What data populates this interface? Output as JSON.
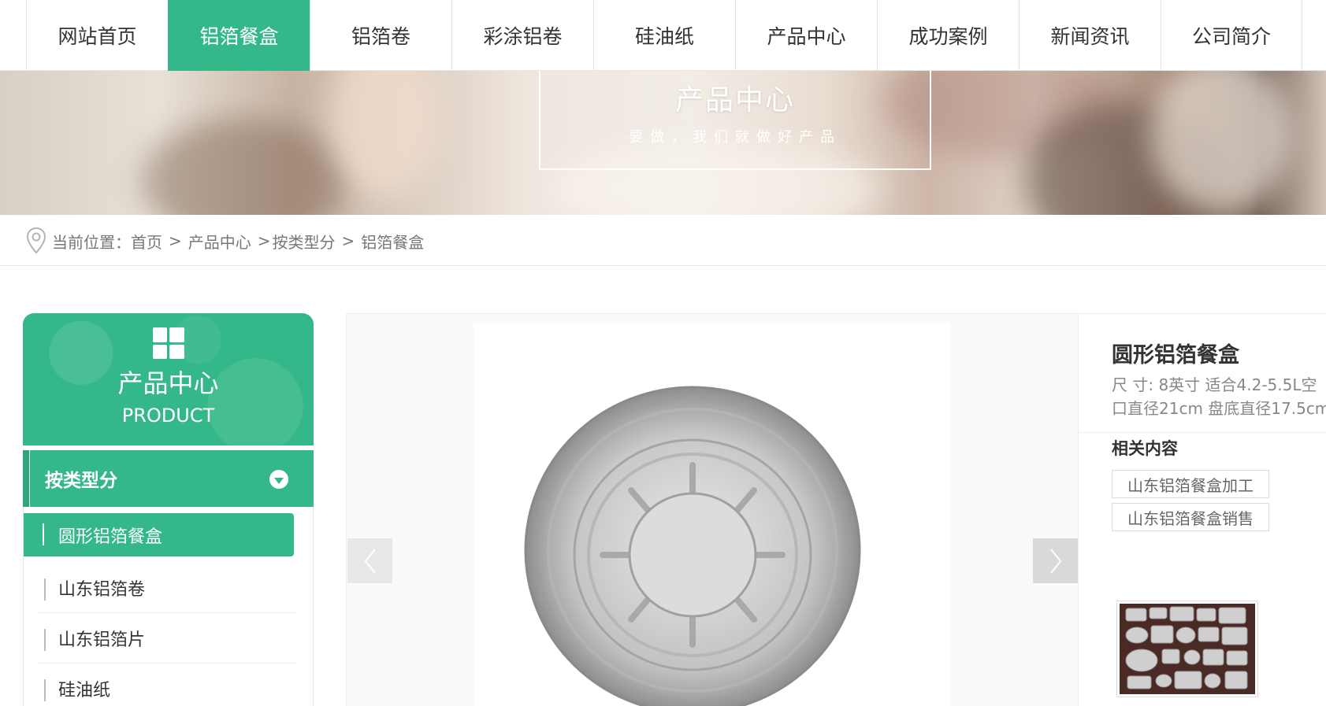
{
  "nav": {
    "items": [
      {
        "label": "网站首页",
        "active": false
      },
      {
        "label": "铝箔餐盒",
        "active": true
      },
      {
        "label": "铝箔卷",
        "active": false
      },
      {
        "label": "彩涂铝卷",
        "active": false
      },
      {
        "label": "硅油纸",
        "active": false
      },
      {
        "label": "产品中心",
        "active": false
      },
      {
        "label": "成功案例",
        "active": false
      },
      {
        "label": "新闻资讯",
        "active": false
      },
      {
        "label": "公司简介",
        "active": false
      }
    ]
  },
  "banner": {
    "title": "产品中心",
    "subtitle": "要做，我们就做好产品"
  },
  "breadcrumb": {
    "prefix": "当前位置：",
    "items": [
      "首页",
      "产品中心",
      "按类型分",
      "铝箔餐盒"
    ],
    "separators": [
      ">",
      ">",
      ">"
    ]
  },
  "sidebar": {
    "title": "产品中心",
    "title_en": "PRODUCT",
    "category": "按类型分",
    "items": [
      {
        "label": "圆形铝箔餐盒",
        "active": true
      },
      {
        "label": "山东铝箔卷",
        "active": false
      },
      {
        "label": "山东铝箔片",
        "active": false
      },
      {
        "label": "硅油纸",
        "active": false
      }
    ]
  },
  "product": {
    "name": "圆形铝箔餐盒",
    "spec_line1": "尺 寸:   8英寸 适合4.2-5.5L空",
    "spec_line2": "口直径21cm 盘底直径17.5cm",
    "related_title": "相关内容",
    "related": [
      "山东铝箔餐盒加工",
      "山东铝箔餐盒销售"
    ]
  },
  "colors": {
    "accent": "#35b889",
    "text": "#333333",
    "muted": "#888888"
  },
  "icons": {
    "location": "location-pin-icon",
    "grid": "grid-icon",
    "toggle": "chevron-down-circle-icon",
    "prev": "chevron-left-icon",
    "next": "chevron-right-icon"
  }
}
